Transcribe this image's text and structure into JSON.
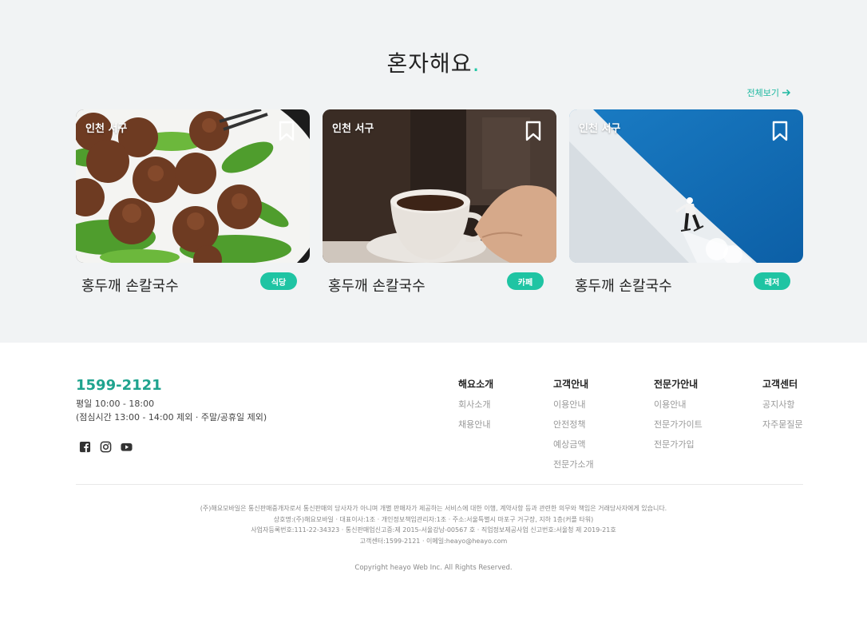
{
  "section": {
    "title": "혼자해요",
    "title_dot": ".",
    "view_all": "전체보기"
  },
  "cards": [
    {
      "location": "인천 서구",
      "title": "홍두깨 손칼국수",
      "tag": "식당",
      "image": "meatballs-salad-photo"
    },
    {
      "location": "인천 서구",
      "title": "홍두깨 손칼국수",
      "tag": "카페",
      "image": "coffee-cup-photo"
    },
    {
      "location": "인천 서구",
      "title": "홍두깨 손칼국수",
      "tag": "레저",
      "image": "skier-slope-photo"
    }
  ],
  "footer": {
    "phone": "1599-2121",
    "hours_line1": "평일 10:00 - 18:00",
    "hours_line2": "(점심시간 13:00 - 14:00 제외 · 주말/공휴일 제외)",
    "socials": [
      "facebook-icon",
      "instagram-icon",
      "youtube-icon"
    ],
    "columns": [
      {
        "heading": "해요소개",
        "links": [
          "회사소개",
          "채용안내"
        ]
      },
      {
        "heading": "고객안내",
        "links": [
          "이용안내",
          "안전정책",
          "예상금액",
          "전문가소개"
        ]
      },
      {
        "heading": "전문가안내",
        "links": [
          "이용안내",
          "전문가가이트",
          "전문가가입"
        ]
      },
      {
        "heading": "고객센터",
        "links": [
          "공지사항",
          "자주묻질문"
        ]
      }
    ],
    "legal_1": "(주)해요모바일은 통신판매중개자로서 통신판매의 당사자가 아니며 개별 판매자가 제공하는 서비스에 대한 이행, 계약사항 등과 관련한 의무와 책임은 거래당사자에게 있습니다.",
    "legal_2": "상호명:(주)해요모바일 · 대표이사:1조 · 개인정보책임관리자:1조 · 주소:서울특별시 마포구 거구장, 지하 1층(커플 타워)",
    "legal_3": "사업자등록번호:111-22-34323 · 통신판매업신고증:제 2015-서울강남-00567 호 · 직업정보제공사업 신고번호:서울청 제 2019-21호",
    "legal_4": "고객센터:1599-2121 · 이메일:heayo@heayo.com",
    "copyright": "Copyright heayo Web Inc. All Rights Reserved."
  },
  "colors": {
    "accent": "#1fc4a3",
    "phone": "#1fa38e",
    "section_bg": "#f1f3f4"
  }
}
